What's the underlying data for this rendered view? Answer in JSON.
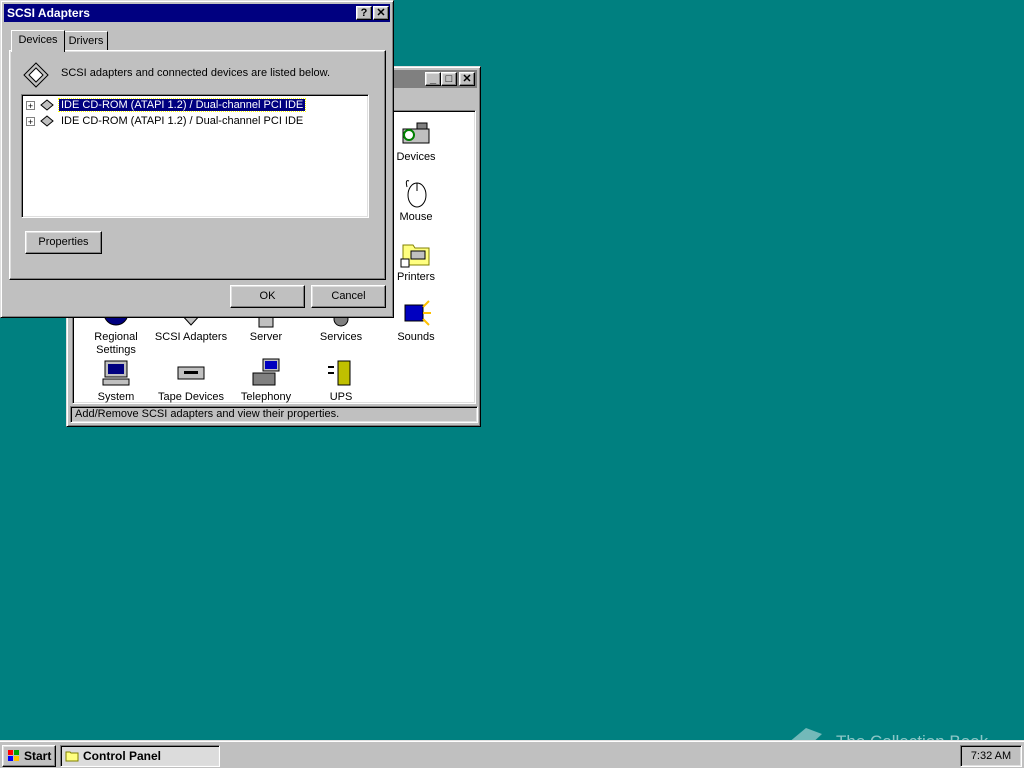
{
  "control_panel": {
    "status_text": "Add/Remove SCSI adapters and view their properties.",
    "icons": [
      {
        "label": "Devices"
      },
      {
        "label": "Mouse"
      },
      {
        "label": "Printers"
      },
      {
        "label": "Regional Settings"
      },
      {
        "label": "SCSI Adapters"
      },
      {
        "label": "Server"
      },
      {
        "label": "Services"
      },
      {
        "label": "Sounds"
      },
      {
        "label": "System"
      },
      {
        "label": "Tape Devices"
      },
      {
        "label": "Telephony"
      },
      {
        "label": "UPS"
      }
    ]
  },
  "dialog": {
    "title": "SCSI Adapters",
    "help_btn": "?",
    "close_btn": "✕",
    "tabs": [
      {
        "label": "Devices"
      },
      {
        "label": "Drivers"
      }
    ],
    "description": "SCSI adapters and connected devices are listed below.",
    "devices": [
      {
        "label": "IDE CD-ROM (ATAPI 1.2) / Dual-channel PCI IDE",
        "selected": true
      },
      {
        "label": "IDE CD-ROM (ATAPI 1.2) / Dual-channel PCI IDE",
        "selected": false
      }
    ],
    "properties_btn": "Properties",
    "ok_btn": "OK",
    "cancel_btn": "Cancel"
  },
  "taskbar": {
    "start_label": "Start",
    "task_label": "Control Panel",
    "clock": "7:32 AM"
  },
  "watermark": "The Collection Book"
}
